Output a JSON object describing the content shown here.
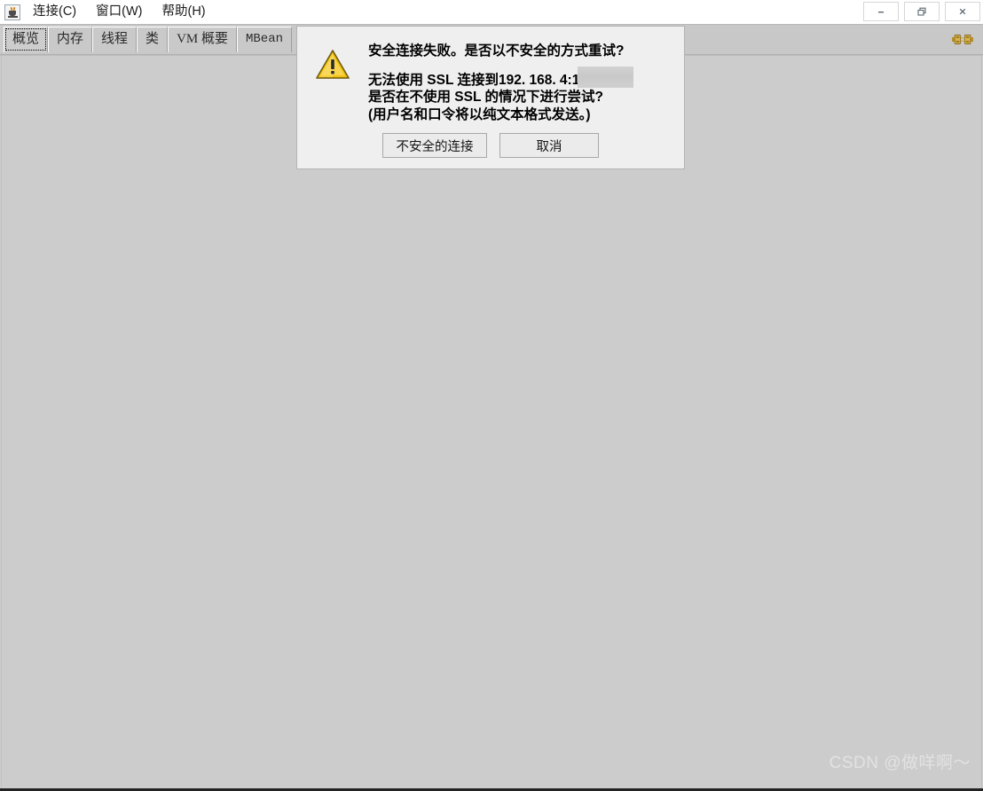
{
  "window": {
    "app_icon_name": "java-coffee-cup-icon",
    "controls": [
      {
        "name": "minimize-button",
        "glyph": "minimize"
      },
      {
        "name": "restore-button",
        "glyph": "restore"
      },
      {
        "name": "close-button",
        "glyph": "close"
      }
    ]
  },
  "menubar": {
    "items": [
      {
        "label": "连接(C)",
        "name": "menu-connect"
      },
      {
        "label": "窗口(W)",
        "name": "menu-window"
      },
      {
        "label": "帮助(H)",
        "name": "menu-help"
      }
    ]
  },
  "toolbar": {
    "connection_icon": "disconnected-plug-icon"
  },
  "tabs": [
    {
      "label": "概览",
      "selected": true,
      "name": "tab-overview"
    },
    {
      "label": "内存",
      "selected": false,
      "name": "tab-memory"
    },
    {
      "label": "线程",
      "selected": false,
      "name": "tab-threads"
    },
    {
      "label": "类",
      "selected": false,
      "name": "tab-classes"
    },
    {
      "label": "VM 概要",
      "selected": false,
      "name": "tab-vm-summary"
    },
    {
      "label": "MBean",
      "selected": false,
      "name": "tab-mbean"
    }
  ],
  "dialog": {
    "icon": "warning-triangle-icon",
    "heading": "安全连接失败。是否以不安全的方式重试?",
    "lines": [
      "无法使用 SSL 连接到192. 168.            4:12345。",
      "是否在不使用 SSL 的情况下进行尝试?",
      "(用户名和口令将以纯文本格式发送。)"
    ],
    "redacted_region": true,
    "buttons": [
      {
        "label": "不安全的连接",
        "name": "insecure-connection-button"
      },
      {
        "label": "取消",
        "name": "cancel-button"
      }
    ]
  },
  "watermark": {
    "text": "CSDN @做咩啊～"
  },
  "colors": {
    "window_background": "#cccccc",
    "toolbar_background": "#c8c8c8",
    "dialog_background": "#efefef",
    "warning_yellow": "#f2c10d",
    "plug_gold": "#b8912c",
    "watermark_gray": "#e2e2e2"
  }
}
